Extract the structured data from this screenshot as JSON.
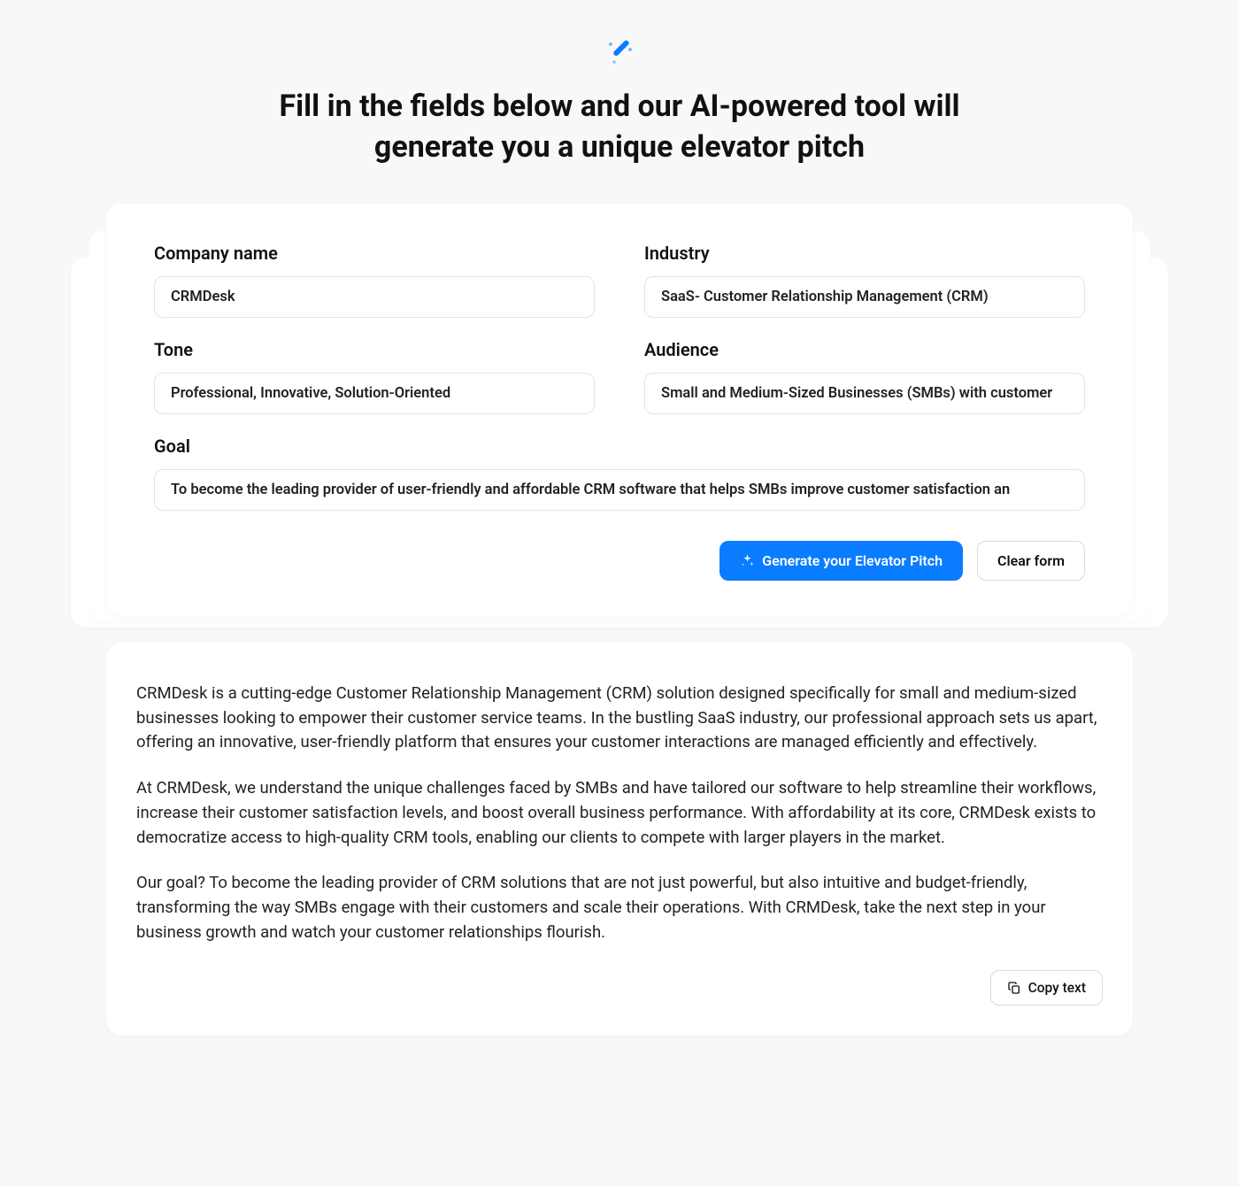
{
  "hero": {
    "title": "Fill in the fields below and our AI-powered tool will generate you a unique elevator pitch"
  },
  "form": {
    "company_name": {
      "label": "Company name",
      "value": "CRMDesk"
    },
    "industry": {
      "label": "Industry",
      "value": "SaaS- Customer Relationship Management (CRM)"
    },
    "tone": {
      "label": "Tone",
      "value": "Professional, Innovative, Solution-Oriented"
    },
    "audience": {
      "label": "Audience",
      "value": "Small and Medium-Sized Businesses (SMBs) with customer"
    },
    "goal": {
      "label": "Goal",
      "value": "To become the leading provider of user-friendly and affordable CRM software that helps SMBs improve customer satisfaction an"
    },
    "actions": {
      "generate_label": "Generate your Elevator Pitch",
      "clear_label": "Clear form"
    }
  },
  "output": {
    "paragraphs": [
      "CRMDesk is a cutting-edge Customer Relationship Management (CRM) solution designed specifically for small and medium-sized businesses looking to empower their customer service teams. In the bustling SaaS industry, our professional approach sets us apart, offering an innovative, user-friendly platform that ensures your customer interactions are managed efficiently and effectively.",
      "At CRMDesk, we understand the unique challenges faced by SMBs and have tailored our software to help streamline their workflows, increase their customer satisfaction levels, and boost overall business performance. With affordability at its core, CRMDesk exists to democratize access to high-quality CRM tools, enabling our clients to compete with larger players in the market.",
      "Our goal? To become the leading provider of CRM solutions that are not just powerful, but also intuitive and budget-friendly, transforming the way SMBs engage with their customers and scale their operations. With CRMDesk, take the next step in your business growth and watch your customer relationships flourish."
    ],
    "copy_label": "Copy text"
  },
  "colors": {
    "primary": "#0a7cff"
  }
}
